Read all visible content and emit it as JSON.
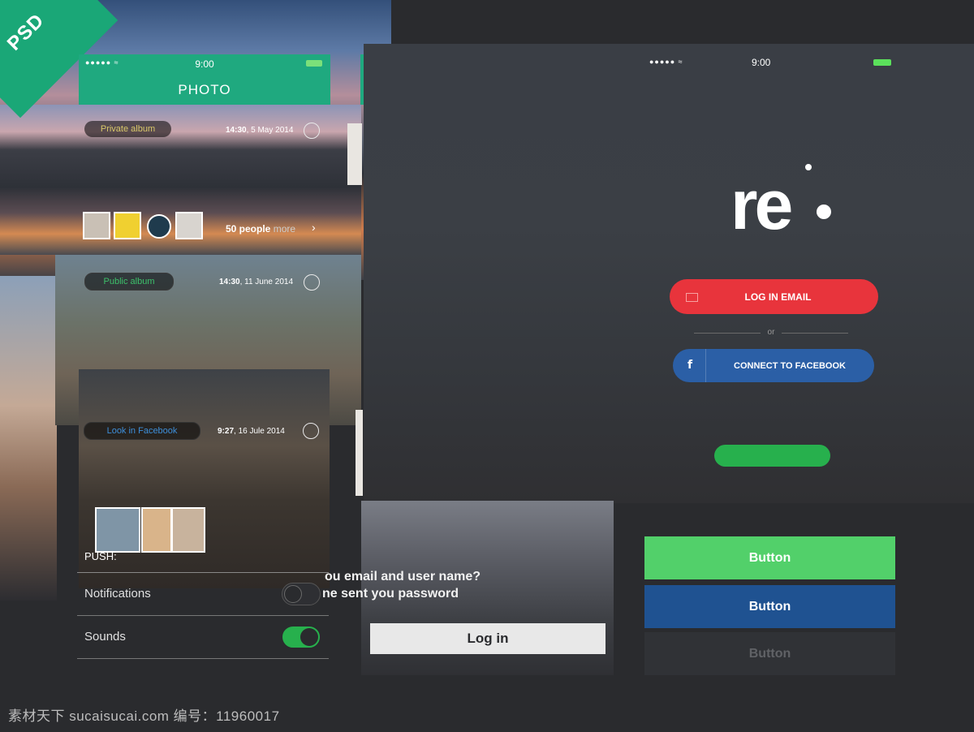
{
  "corner_badge": "PSD",
  "photo_app": {
    "status": {
      "signal": "●●●●● ≈",
      "time": "9:00"
    },
    "title": "PHOTO",
    "albums": [
      {
        "tag": "Private album",
        "time": "14:30",
        "date": ", 5 May 2014",
        "more_count": "50 people",
        "more_label": "more"
      },
      {
        "tag": "Public album",
        "time": "14:30",
        "date": ", 11 June 2014"
      },
      {
        "tag": "Look in Facebook",
        "time": "9:27",
        "date": ", 16 Jule 2014"
      }
    ],
    "accent": "#1fa97f"
  },
  "settings": {
    "section": "PUSH:",
    "rows": [
      {
        "label": "Notifications",
        "on": false
      },
      {
        "label": "Sounds",
        "on": true
      }
    ]
  },
  "login": {
    "status": {
      "signal": "●●●●● ≈",
      "time": "9:00"
    },
    "logo": "re",
    "email_button": "LOG IN EMAIL",
    "or": "or",
    "facebook_button": "CONNECT TO FACEBOOK",
    "facebook_glyph": "f",
    "colors": {
      "email": "#e8343c",
      "facebook": "#2b5fa6",
      "green": "#27b04d"
    }
  },
  "forgot": {
    "line1": "ou email and user name?",
    "line2": "ne sent you password",
    "login_button": "Log in"
  },
  "sample_buttons": [
    "Button",
    "Button",
    "Button"
  ],
  "watermark": "素材天下 sucaisucai.com  编号：11960017"
}
